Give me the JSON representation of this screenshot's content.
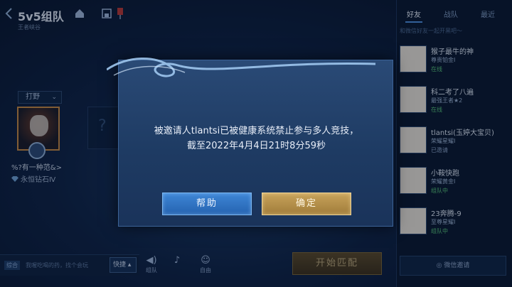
{
  "header": {
    "title": "5v5组队",
    "subtitle": "王者峡谷"
  },
  "player": {
    "lane": "打野",
    "name": "%?有一种范&>",
    "rank": "永恒钻石Ⅳ"
  },
  "bottom_bar": {
    "chat_tag": "综合",
    "chat_placeholder": "我喔吃喝的药，找个会玩",
    "quick_label": "快捷",
    "team_voice_label": "组队",
    "self_voice_label": "自由",
    "start_match_label": "开始匹配"
  },
  "friends_panel": {
    "tabs": [
      {
        "label": "好友",
        "active": true
      },
      {
        "label": "战队",
        "active": false
      },
      {
        "label": "最近",
        "active": false
      }
    ],
    "search_placeholder": "和微信好友一起开黑吧～",
    "friends": [
      {
        "name": "猴子最牛的神",
        "rank": "尊贵铂金Ⅰ",
        "status": "在线"
      },
      {
        "name": "科二考了八遍",
        "rank": "最强王者★2",
        "status": "在线"
      },
      {
        "name": "tlantsi(玉婷大宝贝)",
        "rank": "荣耀星耀Ⅰ",
        "status": "已邀请"
      },
      {
        "name": "小鞍快跑",
        "rank": "荣耀黄金Ⅰ",
        "status": "组队中"
      },
      {
        "name": "23奔腾-9",
        "rank": "至尊星耀Ⅰ",
        "status": "组队中"
      }
    ],
    "wechat_invite_label": "微信邀请"
  },
  "dialog": {
    "message_line1": "被邀请人tlantsi已被健康系统禁止参与多人竞技，",
    "message_line2": "截至2022年4月4日21时8分59秒",
    "help_label": "帮助",
    "confirm_label": "确定"
  },
  "colors": {
    "help_button": "#2f74c4",
    "confirm_button": "#b8924a",
    "online_status": "#57c27a"
  }
}
